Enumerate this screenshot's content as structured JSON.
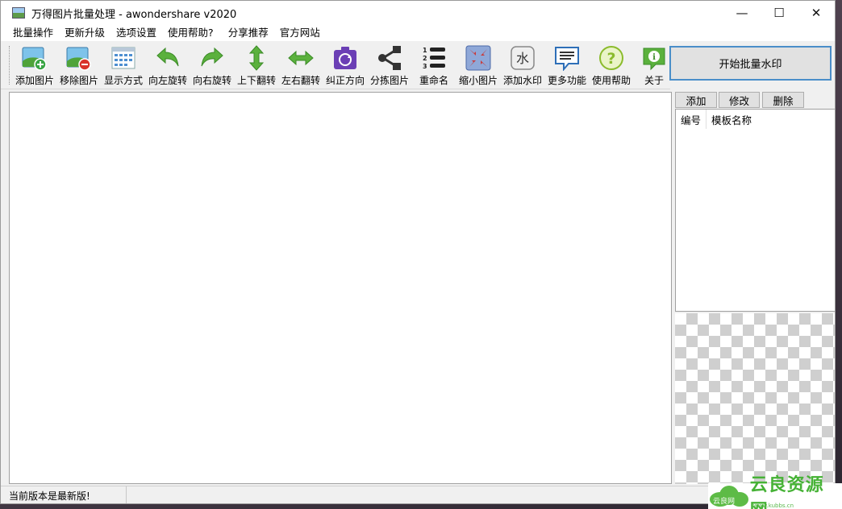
{
  "window": {
    "title": "万得图片批量处理 - awondershare v2020"
  },
  "controls": {
    "minimize": "—",
    "maximize": "☐",
    "close": "✕"
  },
  "menu": [
    "批量操作",
    "更新升级",
    "选项设置",
    "使用帮助?",
    "分享推荐",
    "官方网站"
  ],
  "toolbar": [
    {
      "label": "添加图片",
      "icon": "add-image-icon"
    },
    {
      "label": "移除图片",
      "icon": "remove-image-icon"
    },
    {
      "label": "显示方式",
      "icon": "grid-view-icon"
    },
    {
      "label": "向左旋转",
      "icon": "rotate-left-icon"
    },
    {
      "label": "向右旋转",
      "icon": "rotate-right-icon"
    },
    {
      "label": "上下翻转",
      "icon": "flip-vertical-icon"
    },
    {
      "label": "左右翻转",
      "icon": "flip-horizontal-icon"
    },
    {
      "label": "纠正方向",
      "icon": "correct-orientation-icon"
    },
    {
      "label": "分拣图片",
      "icon": "share-sort-icon"
    },
    {
      "label": "重命名",
      "icon": "numbered-list-icon"
    },
    {
      "label": "缩小图片",
      "icon": "shrink-icon"
    },
    {
      "label": "添加水印",
      "icon": "watermark-icon"
    },
    {
      "label": "更多功能",
      "icon": "speech-bubble-icon"
    },
    {
      "label": "使用帮助",
      "icon": "help-icon"
    },
    {
      "label": "关于",
      "icon": "info-icon"
    }
  ],
  "start_button": "开始批量水印",
  "template_panel": {
    "add": "添加",
    "edit": "修改",
    "delete": "删除",
    "columns": [
      "编号",
      "模板名称"
    ]
  },
  "status": {
    "text": "当前版本是最新版!"
  },
  "watermark": {
    "badge": "云良网",
    "name": "云良资源网",
    "url": "www.kubbs.cn"
  },
  "colors": {
    "accent": "#4a8ec9",
    "green": "#5dbb46",
    "background": "#f0f0f0"
  }
}
